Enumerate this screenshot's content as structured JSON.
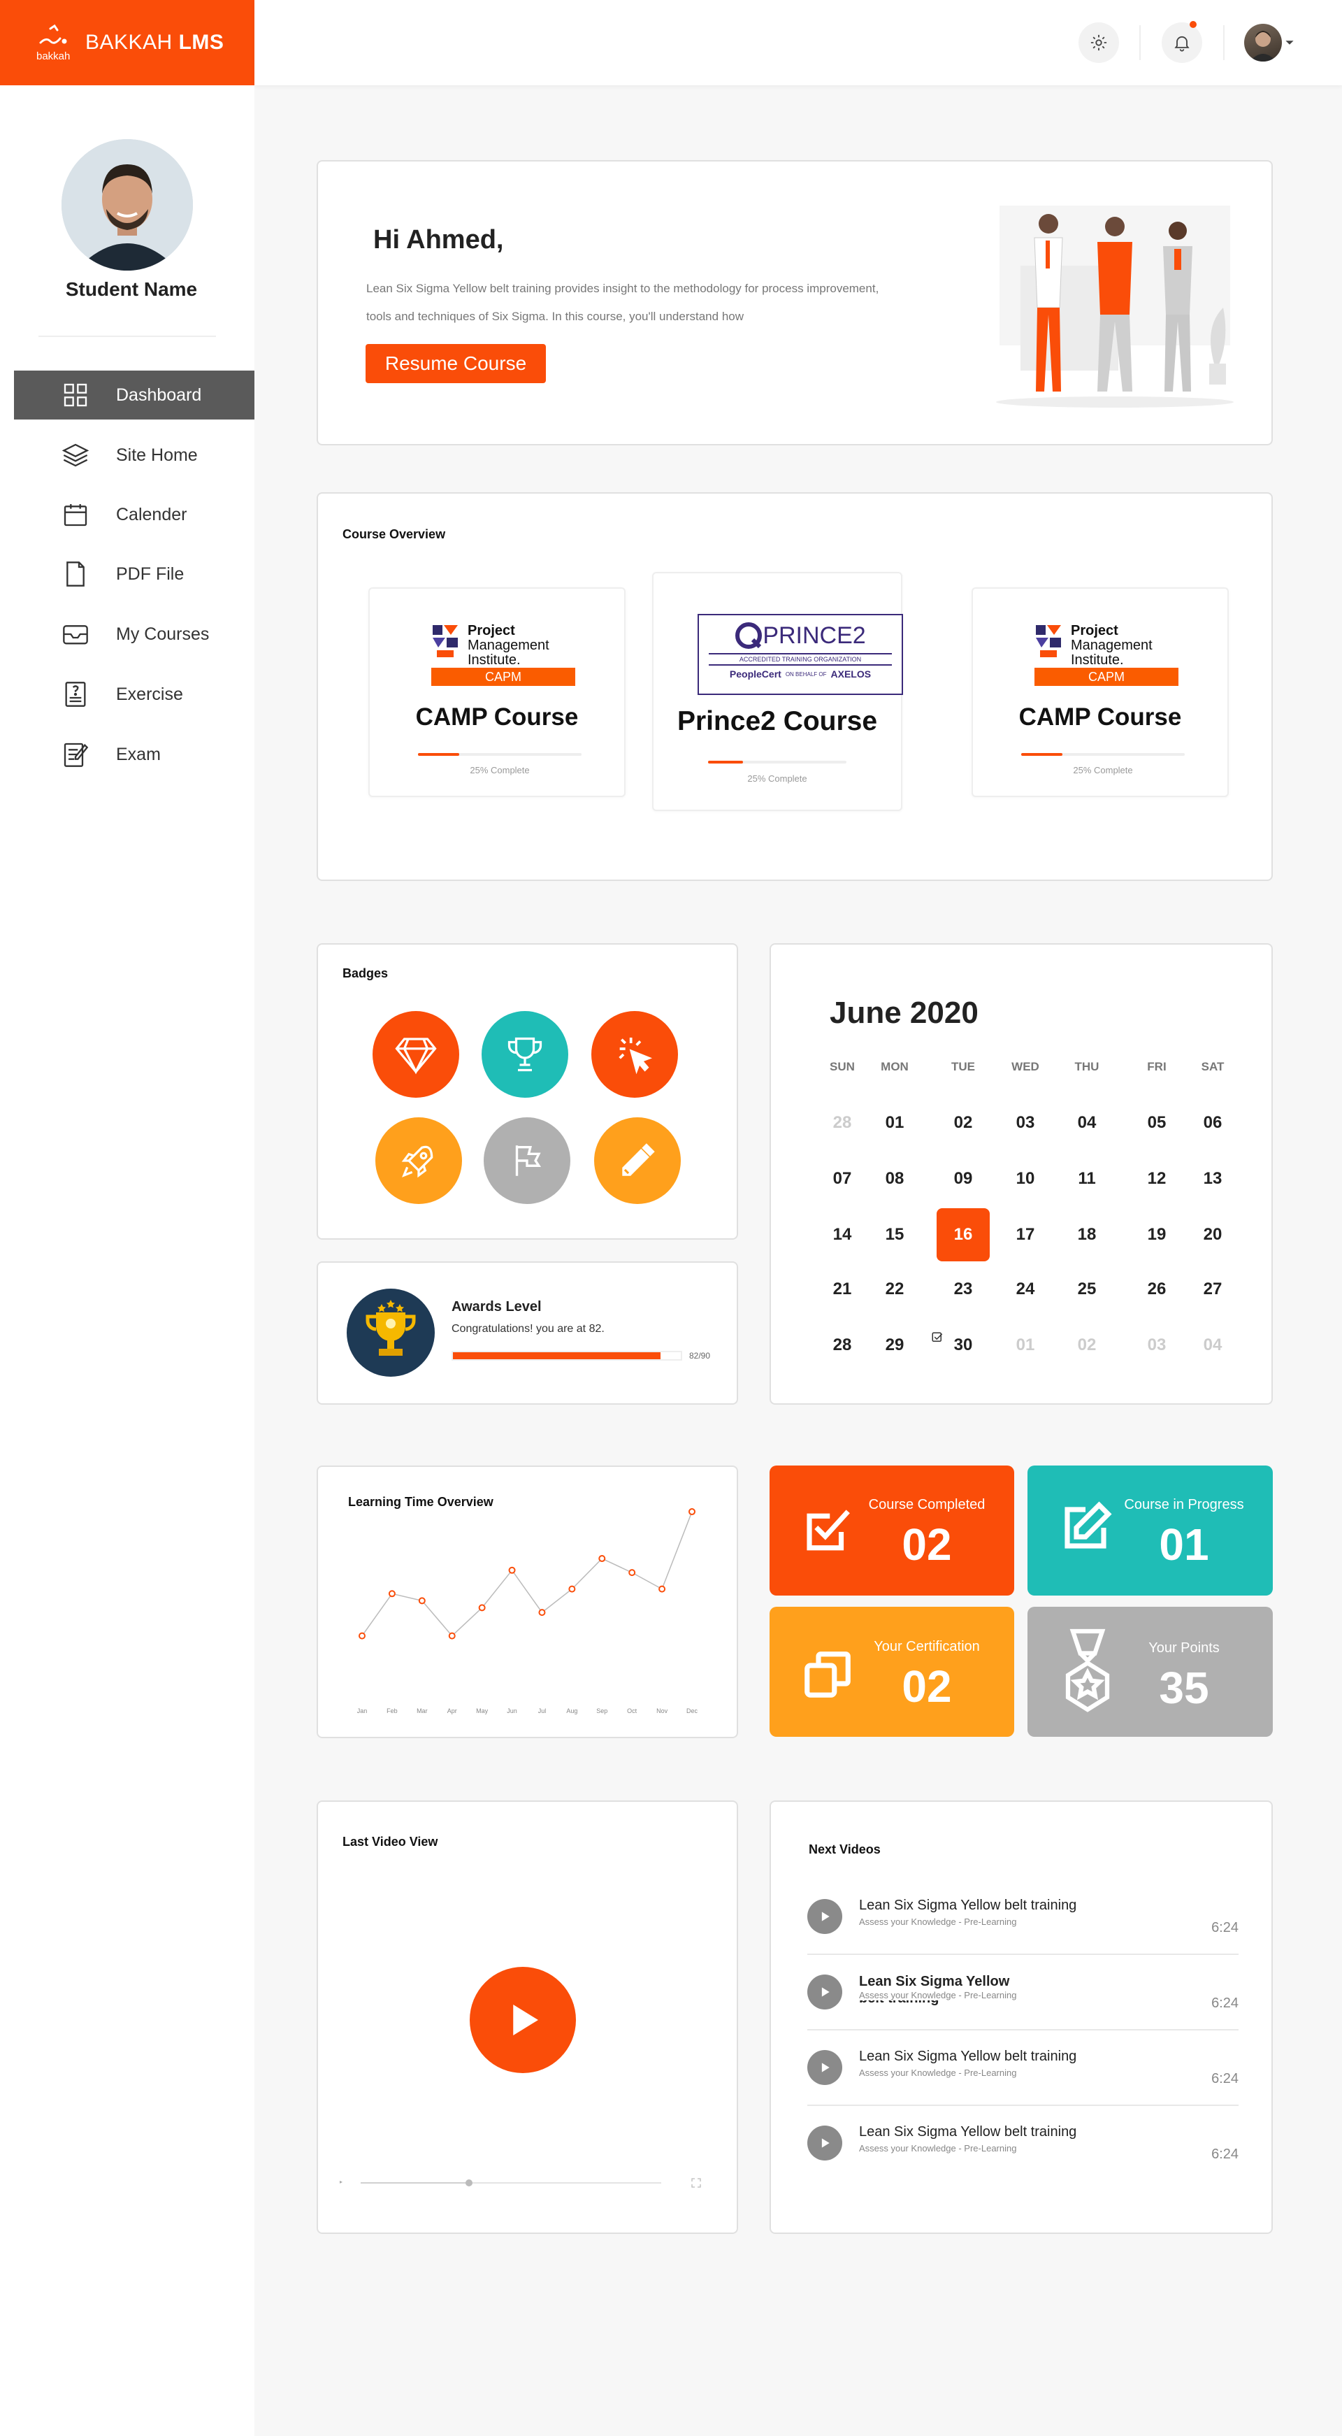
{
  "brand": {
    "name_prefix": "BAKKAH",
    "name_bold": "LMS",
    "mark_caption": "bakkah",
    "color": "#fa4d09"
  },
  "header": {
    "settings_icon": "gear-icon",
    "notification_icon": "bell-icon"
  },
  "sidebar": {
    "student_name": "Student Name",
    "items": [
      {
        "label": "Dashboard",
        "icon": "grid-icon",
        "active": true
      },
      {
        "label": "Site Home",
        "icon": "layers-icon"
      },
      {
        "label": "Calender",
        "icon": "calendar-icon"
      },
      {
        "label": "PDF File",
        "icon": "file-icon"
      },
      {
        "label": "My Courses",
        "icon": "inbox-icon"
      },
      {
        "label": "Exercise",
        "icon": "exercise-icon"
      },
      {
        "label": "Exam",
        "icon": "exam-icon"
      }
    ]
  },
  "welcome": {
    "greeting": "Hi Ahmed,",
    "line1": "Lean Six Sigma Yellow belt training provides insight to the methodology for process improvement,",
    "line2": "tools and techniques of  Six Sigma. In this course, you'll understand how",
    "button": "Resume Course"
  },
  "course_overview": {
    "title": "Course Overview",
    "courses": [
      {
        "name": "CAMP Course",
        "progress_label": "25% Complete",
        "progress": 0.25,
        "logo_line1": "Project",
        "logo_line2": "Management",
        "logo_line3": "Institute.",
        "logo_badge": "CAPM"
      },
      {
        "name": "Prince2 Course",
        "progress_label": "25% Complete",
        "progress": 0.25,
        "logo_main": "PRINCE2",
        "logo_sub": "ACCREDITED TRAINING ORGANIZATION",
        "logo_foot_left": "PeopleCert",
        "logo_foot_mid": "ON BEHALF OF",
        "logo_foot_right": "AXELOS"
      },
      {
        "name": "CAMP Course",
        "progress_label": "25% Complete",
        "progress": 0.25,
        "logo_line1": "Project",
        "logo_line2": "Management",
        "logo_line3": "Institute.",
        "logo_badge": "CAPM"
      }
    ]
  },
  "badges": {
    "title": "Badges",
    "items": [
      {
        "icon": "diamond-icon",
        "color": "#fa4d09"
      },
      {
        "icon": "trophy-icon",
        "color": "#1fbdb6"
      },
      {
        "icon": "cursor-click-icon",
        "color": "#fa4d09"
      },
      {
        "icon": "rocket-icon",
        "color": "#ffa01c"
      },
      {
        "icon": "flag-icon",
        "color": "#b0b0b0"
      },
      {
        "icon": "pencil-icon",
        "color": "#ffa01c"
      }
    ]
  },
  "awards": {
    "title": "Awards Level",
    "text": "Congratulations! you are at 82.",
    "value_label": "82/90",
    "progress": 0.9111
  },
  "calendar": {
    "title": "June 2020",
    "days_of_week": [
      "SUN",
      "MON",
      "TUE",
      "WED",
      "THU",
      "FRI",
      "SAT"
    ],
    "weeks": [
      [
        "28",
        "01",
        "02",
        "03",
        "04",
        "05",
        "06"
      ],
      [
        "07",
        "08",
        "09",
        "10",
        "11",
        "12",
        "13"
      ],
      [
        "14",
        "15",
        "16",
        "17",
        "18",
        "19",
        "20"
      ],
      [
        "21",
        "22",
        "23",
        "24",
        "25",
        "26",
        "27"
      ],
      [
        "28",
        "29",
        "30",
        "01",
        "02",
        "03",
        "04"
      ]
    ]
  },
  "learning_time": {
    "title": "Learning Time Overview"
  },
  "chart_data": {
    "type": "line",
    "title": "Learning Time Overview",
    "categories": [
      "Jan",
      "Feb",
      "Mar",
      "Apr",
      "May",
      "Jun",
      "Jul",
      "Aug",
      "Sep",
      "Oct",
      "Nov",
      "Dec"
    ],
    "values": [
      24,
      42,
      39,
      24,
      36,
      52,
      34,
      44,
      57,
      51,
      44,
      77
    ],
    "xlabel": "",
    "ylabel": "",
    "ylim": [
      0,
      80
    ],
    "grid": false,
    "color": "#fa4d09"
  },
  "stats": [
    {
      "label": "Course Completed",
      "value": "02",
      "icon": "check-square-icon",
      "color": "#fa4d09"
    },
    {
      "label": "Course in Progress",
      "value": "01",
      "icon": "edit-square-icon",
      "color": "#1fbdb6"
    },
    {
      "label": "Your Certification",
      "value": "02",
      "icon": "copy-icon",
      "color": "#ffa01c"
    },
    {
      "label": "Your Points",
      "value": "35",
      "icon": "medal-icon",
      "color": "#b0b0b0"
    }
  ],
  "last_video": {
    "title": "Last Video View",
    "progress": 0.36
  },
  "next_videos": {
    "title": "Next Videos",
    "items": [
      {
        "title": "Lean Six Sigma Yellow belt training",
        "subtitle": "Assess your Knowledge - Pre-Learning",
        "duration": "6:24",
        "bold": false
      },
      {
        "title": "Lean Six Sigma Yellow belt training",
        "subtitle": "Assess your Knowledge - Pre-Learning",
        "duration": "6:24",
        "bold": true
      },
      {
        "title": "Lean Six Sigma Yellow belt training",
        "subtitle": "Assess your Knowledge - Pre-Learning",
        "duration": "6:24",
        "bold": false
      },
      {
        "title": "Lean Six Sigma Yellow belt training",
        "subtitle": "Assess your Knowledge - Pre-Learning",
        "duration": "6:24",
        "bold": false
      }
    ]
  }
}
